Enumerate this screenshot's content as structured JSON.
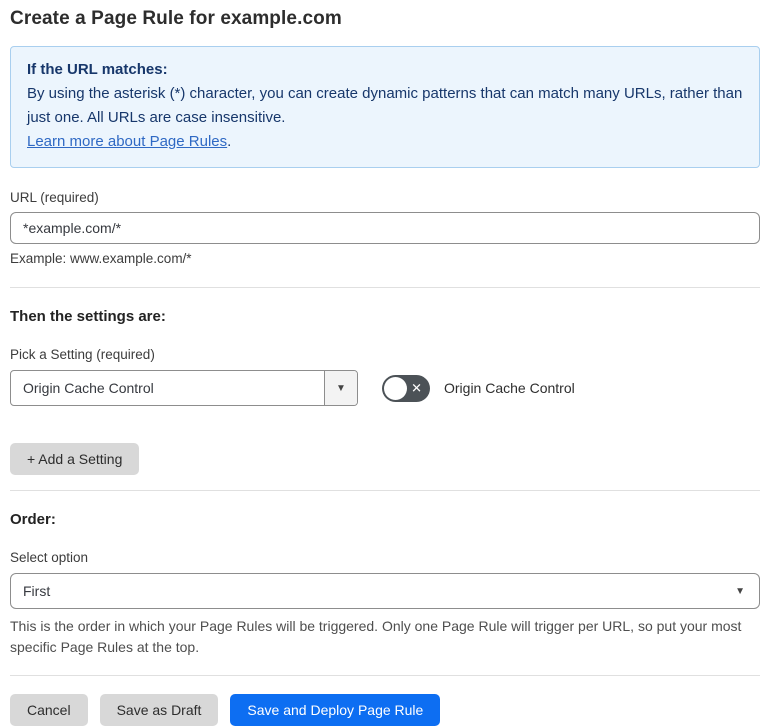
{
  "page": {
    "title": "Create a Page Rule for example.com"
  },
  "info_box": {
    "heading": "If the URL matches:",
    "body": "By using the asterisk (*) character, you can create dynamic patterns that can match many URLs, rather than just one. All URLs are case insensitive.",
    "link": "Learn more about Page Rules",
    "link_suffix": "."
  },
  "url_field": {
    "label": "URL (required)",
    "value": "*example.com/*",
    "helper": "Example: www.example.com/*"
  },
  "settings_section": {
    "heading": "Then the settings are:",
    "pick_label": "Pick a Setting (required)",
    "selected_setting": "Origin Cache Control",
    "toggle_label": "Origin Cache Control",
    "toggle_state": "off",
    "add_button": "+ Add a Setting"
  },
  "order_section": {
    "heading": "Order:",
    "select_label": "Select option",
    "selected_option": "First",
    "help": "This is the order in which your Page Rules will be triggered. Only one Page Rule will trigger per URL, so put your most specific Page Rules at the top."
  },
  "footer": {
    "cancel": "Cancel",
    "save_draft": "Save as Draft",
    "save_deploy": "Save and Deploy Page Rule"
  },
  "icons": {
    "caret_down": "▼",
    "toggle_x": "✕"
  },
  "colors": {
    "accent_blue": "#0d6ef2",
    "info_bg": "#ecf5fd",
    "info_border": "#a9cfef",
    "info_text": "#17376b",
    "link_blue": "#2f69c4",
    "toggle_track": "#4c5257",
    "button_gray": "#d8d8d8"
  }
}
